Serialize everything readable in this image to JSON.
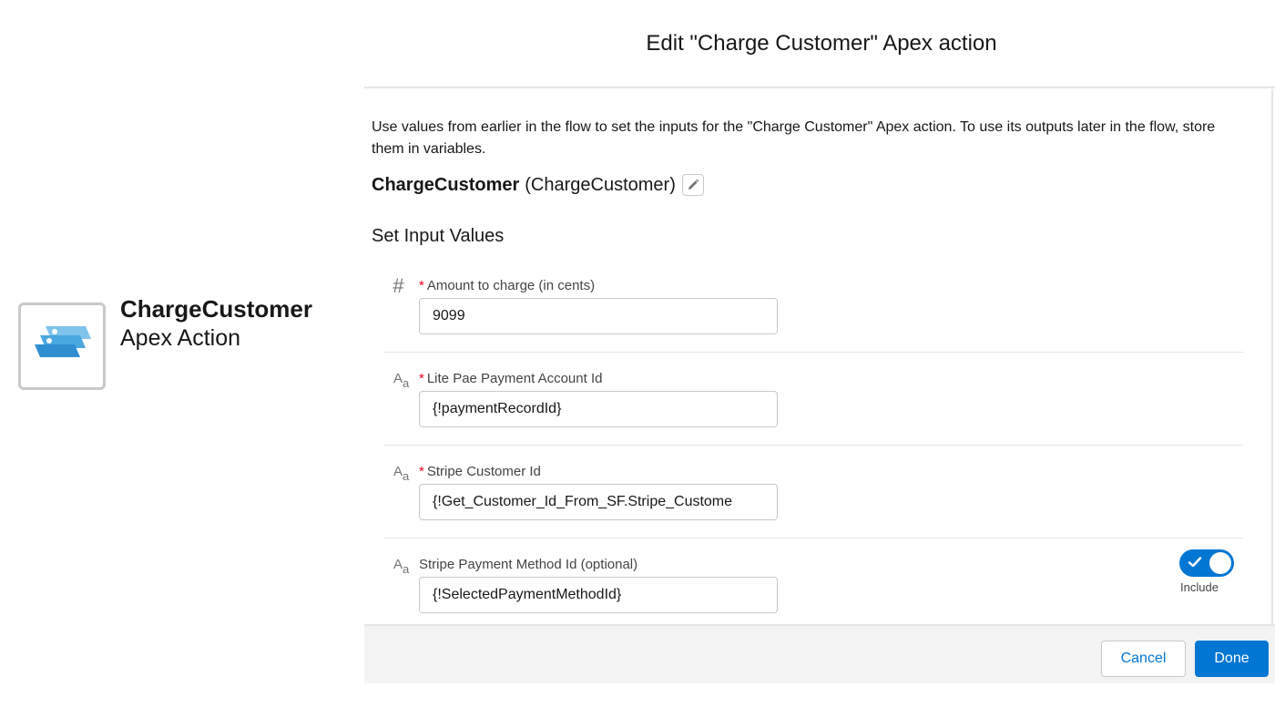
{
  "canvas_node": {
    "icon": "stacked-cards-icon",
    "title": "ChargeCustomer",
    "subtitle": "Apex Action"
  },
  "modal": {
    "title": "Edit \"Charge Customer\" Apex action",
    "intro": "Use values from earlier in the flow to set the inputs for the \"Charge Customer\" Apex action. To use its outputs later in the flow, store them in variables.",
    "action_label": "ChargeCustomer",
    "action_api_name": "(ChargeCustomer)",
    "section_title": "Set Input Values",
    "params": [
      {
        "type_icon": "number-hash-icon",
        "required": true,
        "label": "Amount to charge (in cents)",
        "value": "9099"
      },
      {
        "type_icon": "text-aa-icon",
        "required": true,
        "label": "Lite Pae Payment Account Id",
        "value": "{!paymentRecordId}"
      },
      {
        "type_icon": "text-aa-icon",
        "required": true,
        "label": "Stripe Customer Id",
        "value": "{!Get_Customer_Id_From_SF.Stripe_Custome"
      },
      {
        "type_icon": "text-aa-icon",
        "required": false,
        "label": "Stripe Payment Method Id (optional)",
        "value": "{!SelectedPaymentMethodId}",
        "include": true,
        "include_label": "Include"
      }
    ],
    "required_marker": "*",
    "type_hash": "#",
    "type_aa_big": "A",
    "type_aa_small": "a",
    "footer": {
      "cancel_label": "Cancel",
      "done_label": "Done"
    }
  },
  "colors": {
    "brand": "#0176d3",
    "required": "#ea001e",
    "footer_bg": "#f3f3f3"
  }
}
